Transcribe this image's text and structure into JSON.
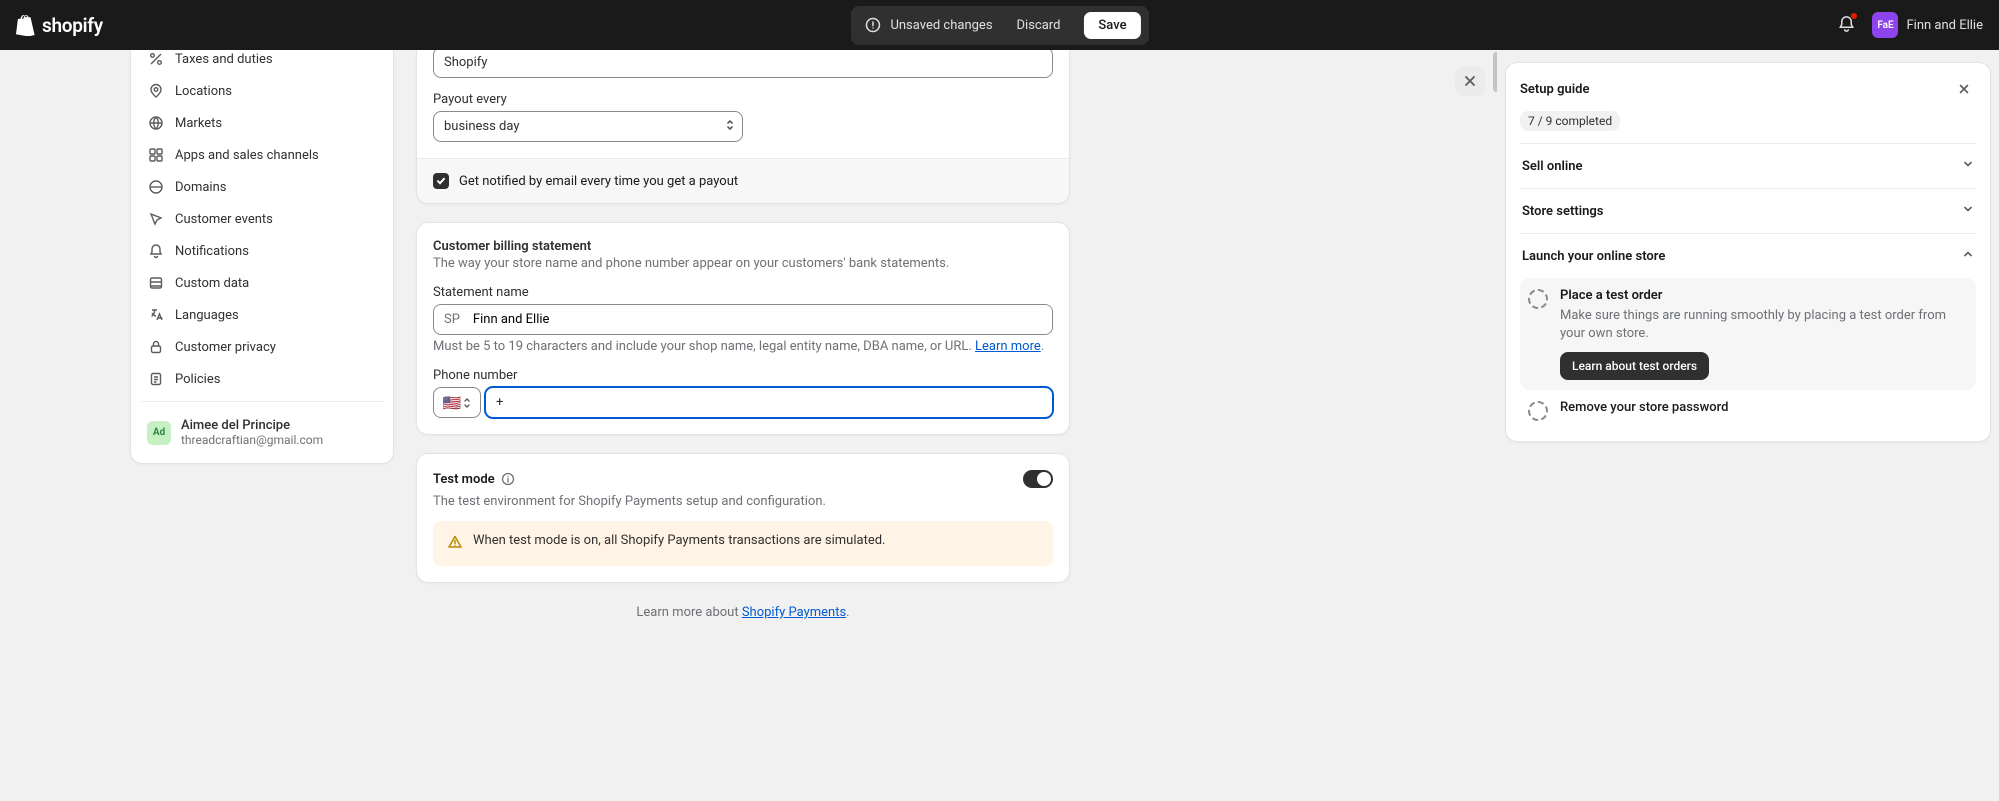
{
  "header": {
    "unsaved": "Unsaved changes",
    "discard": "Discard",
    "save": "Save",
    "store_name": "Finn and Ellie",
    "avatar_initials": "FaE"
  },
  "sidebar": {
    "items": [
      {
        "label": "Taxes and duties",
        "icon": "percent"
      },
      {
        "label": "Locations",
        "icon": "pin"
      },
      {
        "label": "Markets",
        "icon": "globe"
      },
      {
        "label": "Apps and sales channels",
        "icon": "grid"
      },
      {
        "label": "Domains",
        "icon": "globe2"
      },
      {
        "label": "Customer events",
        "icon": "cursor"
      },
      {
        "label": "Notifications",
        "icon": "bell"
      },
      {
        "label": "Custom data",
        "icon": "db"
      },
      {
        "label": "Languages",
        "icon": "lang"
      },
      {
        "label": "Customer privacy",
        "icon": "lock"
      },
      {
        "label": "Policies",
        "icon": "doc"
      }
    ],
    "user": {
      "initials": "Ad",
      "name": "Aimee del Principe",
      "email": "threadcraftian@gmail.com"
    }
  },
  "form": {
    "name_value": "Shopify",
    "payout_label": "Payout every",
    "payout_value": "business day",
    "notify_label": "Get notified by email every time you get a payout",
    "billing_title": "Customer billing statement",
    "billing_desc": "The way your store name and phone number appear on your customers' bank statements.",
    "statement_label": "Statement name",
    "statement_prefix": "SP",
    "statement_value": "Finn and Ellie",
    "statement_help_a": "Must be 5 to 19 characters and include your shop name, legal entity name, DBA name, or URL. ",
    "statement_help_link": "Learn more",
    "statement_help_b": ".",
    "phone_label": "Phone number",
    "phone_flag": "🇺🇸",
    "phone_value": "+",
    "test_title": "Test mode",
    "test_desc": "The test environment for Shopify Payments setup and configuration.",
    "test_alert": "When test mode is on, all Shopify Payments transactions are simulated.",
    "foot_a": "Learn more about ",
    "foot_link": "Shopify Payments",
    "foot_b": "."
  },
  "guide": {
    "title": "Setup guide",
    "progress": "7 / 9 completed",
    "sections": [
      {
        "label": "Sell online"
      },
      {
        "label": "Store settings"
      },
      {
        "label": "Launch your online store"
      }
    ],
    "tasks": [
      {
        "title": "Place a test order",
        "desc": "Make sure things are running smoothly by placing a test order from your own store.",
        "btn": "Learn about test orders"
      },
      {
        "title": "Remove your store password"
      }
    ]
  }
}
